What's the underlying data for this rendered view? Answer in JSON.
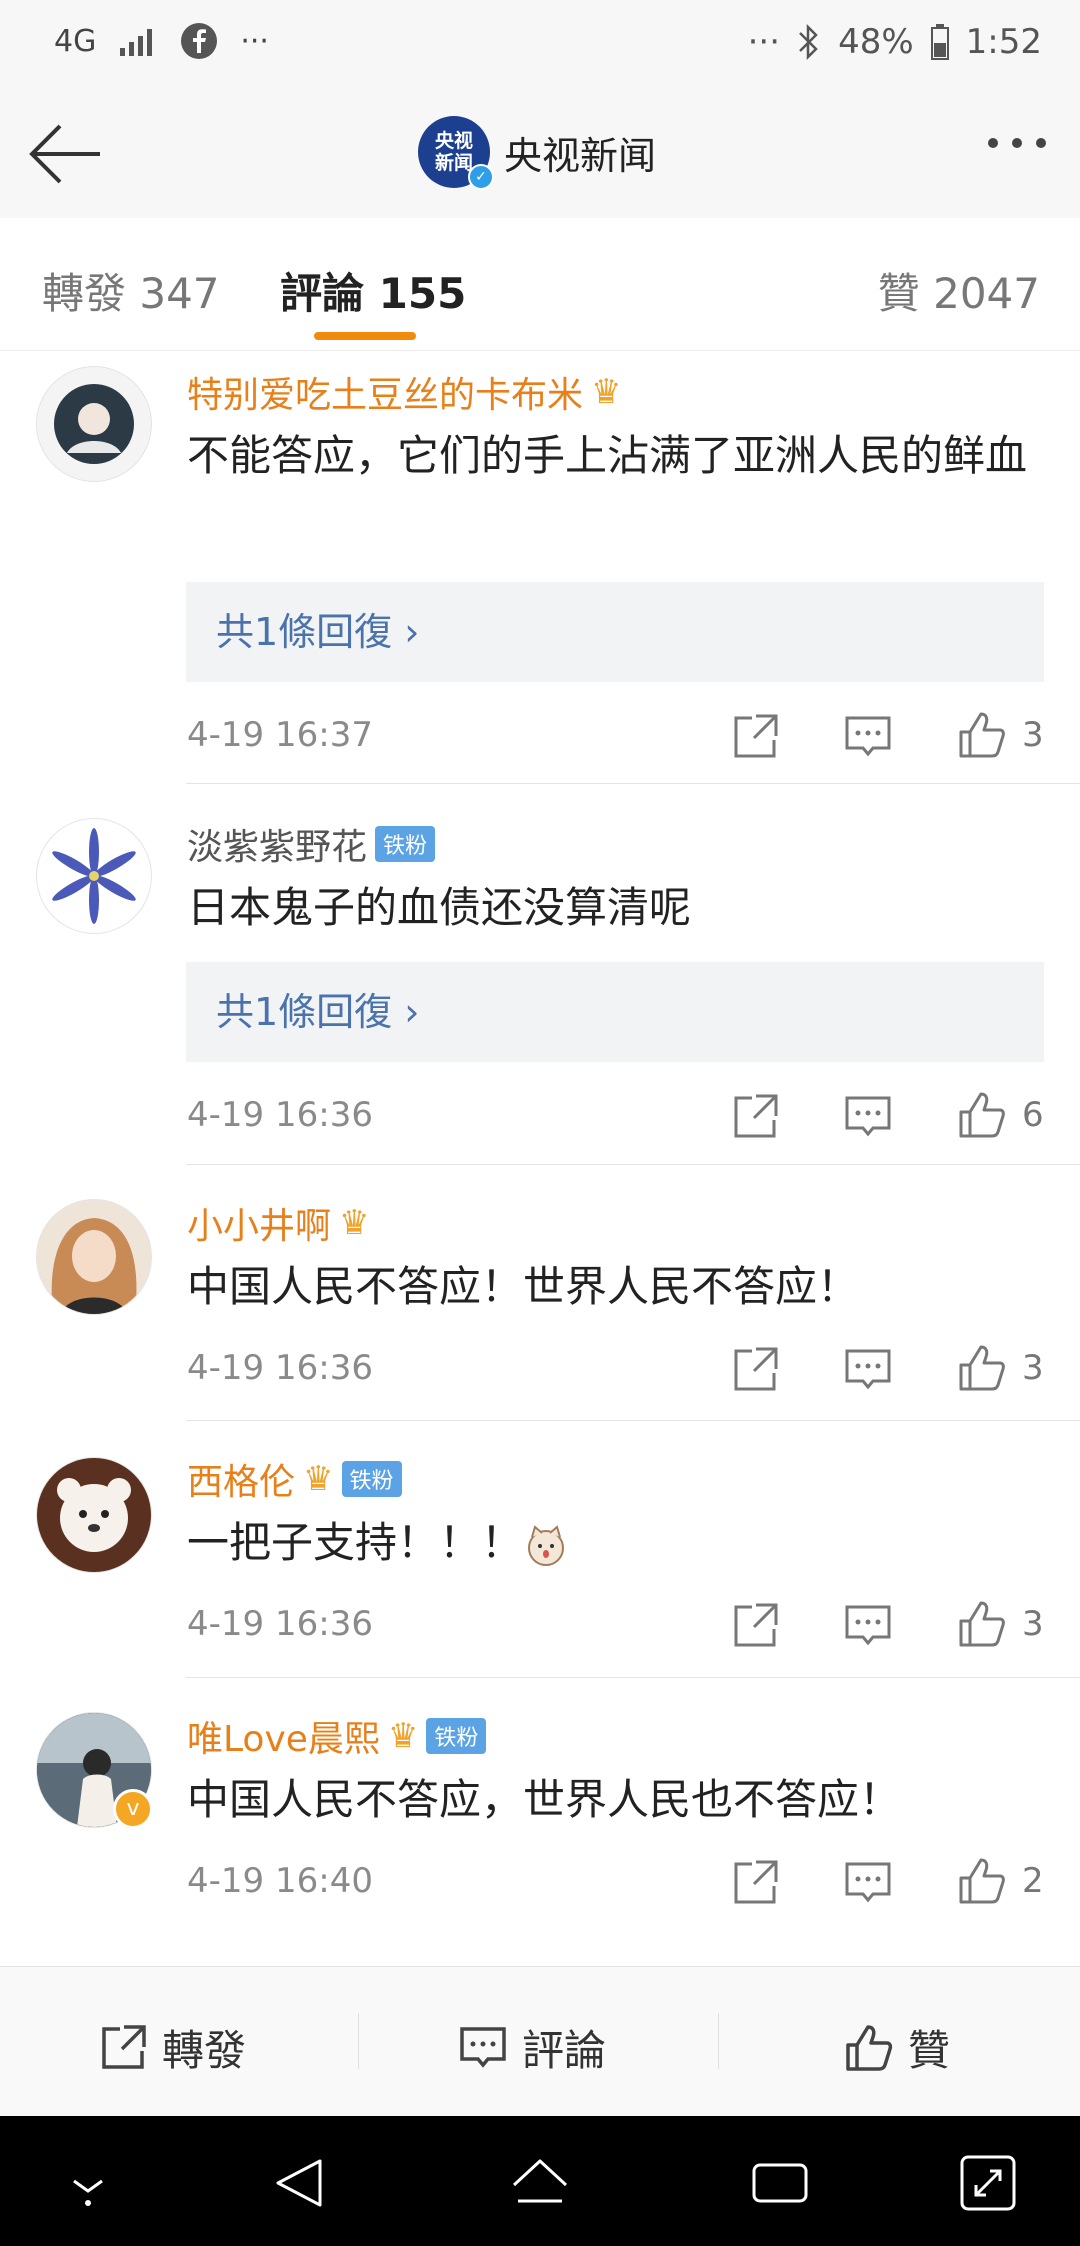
{
  "status_bar": {
    "network": "4G",
    "dots_left": "···",
    "dots_right": "···",
    "battery": "48%",
    "time": "1:52"
  },
  "header": {
    "logo_text": "央视新闻",
    "account_name": "央视新闻"
  },
  "tabs": {
    "repost": "轉發 347",
    "comments": "評論 155",
    "likes": "贊 2047"
  },
  "comments": [
    {
      "username": "特别爱吃土豆丝的卡布米",
      "text": "不能答应，它们的手上沾满了亚洲人民的鲜血",
      "reply": "共1條回復 ›",
      "time": "4-19 16:37",
      "likes": "3"
    },
    {
      "username": "淡紫紫野花",
      "badge": "铁粉",
      "text": "日本鬼子的血债还没算清呢",
      "reply": "共1條回復 ›",
      "time": "4-19 16:36",
      "likes": "6"
    },
    {
      "username": "小小井啊",
      "text": "中国人民不答应！世界人民不答应！",
      "time": "4-19 16:36",
      "likes": "3"
    },
    {
      "username": "西格伦",
      "badge": "铁粉",
      "text": "一把子支持！！！",
      "time": "4-19 16:36",
      "likes": "3"
    },
    {
      "username": "唯Love晨熙",
      "badge": "铁粉",
      "text": "中国人民不答应，世界人民也不答应！",
      "time": "4-19 16:40",
      "likes": "2"
    }
  ],
  "bottom_bar": {
    "repost": "轉發",
    "comment": "評論",
    "like": "贊"
  },
  "colors": {
    "accent_orange": "#f48a0a",
    "vip_name": "#e7801a",
    "reply_link": "#4a73ac",
    "fan_badge": "#5ba3e4"
  }
}
